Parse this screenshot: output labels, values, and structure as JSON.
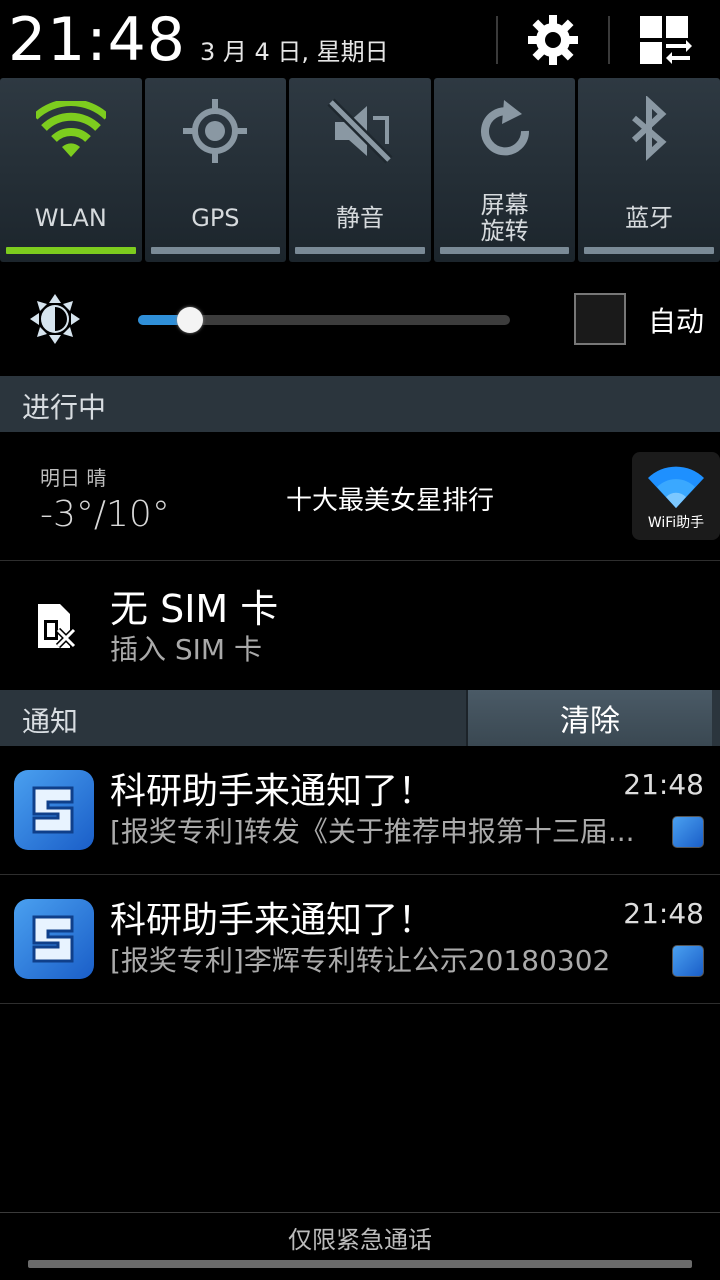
{
  "status_header": {
    "time": "21:48",
    "date": "3 月 4 日, 星期日",
    "settings_icon": "gear-icon",
    "edit_icon": "grid-edit-icon"
  },
  "quick_toggles": [
    {
      "label": "WLAN",
      "icon": "wifi-icon",
      "on": true
    },
    {
      "label": "GPS",
      "icon": "gps-icon",
      "on": false
    },
    {
      "label": "静音",
      "icon": "mute-icon",
      "on": false
    },
    {
      "label": "屏幕\n旋转",
      "icon": "rotate-icon",
      "on": false
    },
    {
      "label": "蓝牙",
      "icon": "bluetooth-icon",
      "on": false
    }
  ],
  "brightness": {
    "icon": "brightness-icon",
    "level": 0.14,
    "auto_label": "自动",
    "auto_checked": false
  },
  "ongoing_section": {
    "title": "进行中"
  },
  "weather": {
    "day": "明日 晴",
    "temp": "-3°/10°",
    "headline": "十大最美女星排行",
    "helper_label": "WiFi助手"
  },
  "sim": {
    "title": "无 SIM 卡",
    "subtitle": "插入 SIM 卡"
  },
  "notifications_section": {
    "title": "通知",
    "clear_label": "清除"
  },
  "notifications": [
    {
      "title": "科研助手来通知了！",
      "time": "21:48",
      "body": "[报奖专利]转发《关于推荐申报第十三届..."
    },
    {
      "title": "科研助手来通知了！",
      "time": "21:48",
      "body": "[报奖专利]李辉专利转让公示20180302"
    }
  ],
  "footer": {
    "emergency": "仅限紧急通话"
  },
  "colors": {
    "accent_green": "#7dcc1e",
    "slider_blue": "#2f8fd8",
    "app_blue": "#2a7ae0"
  }
}
